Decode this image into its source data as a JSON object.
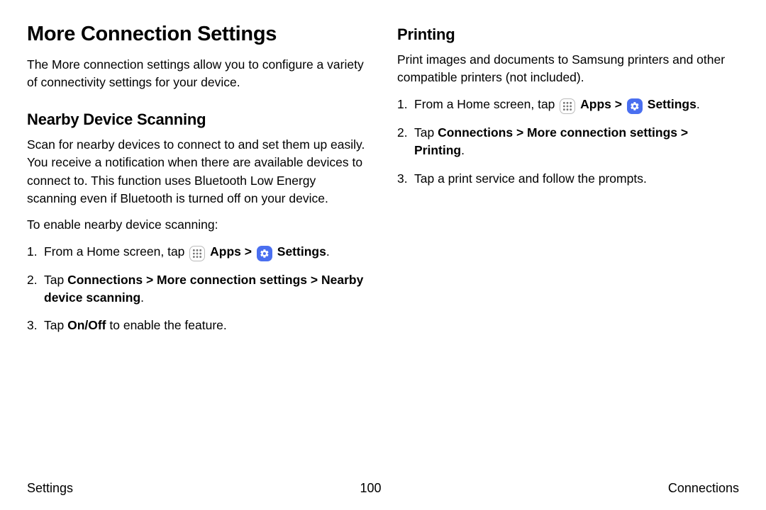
{
  "left": {
    "title": "More Connection Settings",
    "intro": "The More connection settings allow you to configure a variety of connectivity settings for your device.",
    "section_heading": "Nearby Device Scanning",
    "section_body": "Scan for nearby devices to connect to and set them up easily. You receive a notification when there are available devices to connect to. This function uses Bluetooth Low Energy scanning even if Bluetooth is turned off on your device.",
    "enable_line": "To enable nearby device scanning:",
    "step1_pre": "From a Home screen, tap ",
    "apps_label": "Apps",
    "settings_label": "Settings",
    "step2_tap": "Tap ",
    "step2_conn": "Connections",
    "step2_more": "More connection settings",
    "step2_target": "Nearby device scanning",
    "step3_pre": "Tap ",
    "step3_bold": "On/Off",
    "step3_post": " to enable the feature."
  },
  "right": {
    "heading": "Printing",
    "body": "Print images and documents to Samsung printers and other compatible printers (not included).",
    "step1_pre": "From a Home screen, tap ",
    "apps_label": "Apps",
    "settings_label": "Settings",
    "step2_tap": "Tap ",
    "step2_conn": "Connections",
    "step2_more": "More connection settings",
    "step2_target": "Printing",
    "step3": "Tap a print service and follow the prompts."
  },
  "footer": {
    "left": "Settings",
    "center": "100",
    "right": "Connections"
  },
  "nums": {
    "n1": "1.",
    "n2": "2.",
    "n3": "3."
  },
  "period": ".",
  "chev": ">"
}
